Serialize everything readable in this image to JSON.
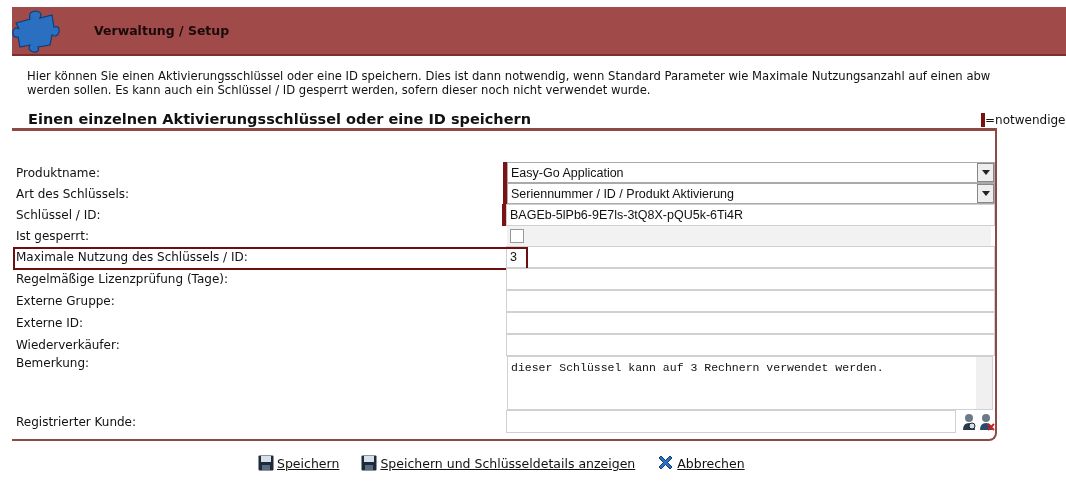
{
  "header": {
    "title": "Verwaltung / Setup"
  },
  "description": [
    "Hier können Sie einen Aktivierungsschlüssel oder eine ID speichern. Dies ist dann notwendig, wenn Standard Parameter wie Maximale Nutzungsanzahl auf einen abw",
    "werden sollen. Es kann auch ein Schlüssel / ID gesperrt werden, sofern dieser noch nicht verwendet wurde."
  ],
  "section": {
    "title": "Einen einzelnen Aktivierungsschlüssel oder eine ID speichern",
    "legend": "=notwendige"
  },
  "fields": [
    {
      "kind": "select",
      "label": "Produktname:",
      "value": "Easy-Go Application",
      "required": true,
      "highlighted": false
    },
    {
      "kind": "select",
      "label": "Art des Schlüssels:",
      "value": "Seriennummer / ID / Produkt Aktivierung",
      "required": true,
      "highlighted": false
    },
    {
      "kind": "text",
      "label": "Schlüssel / ID:",
      "value": "BAGEb-5lPb6-9E7ls-3tQ8X-pQU5k-6Ti4R",
      "required": true,
      "highlighted": false
    },
    {
      "kind": "checkbox",
      "label": "Ist gesperrt:",
      "checked": false,
      "required": false,
      "highlighted": false
    },
    {
      "kind": "text",
      "label": "Maximale Nutzung des Schlüssels / ID:",
      "value": "3",
      "required": false,
      "highlighted": true
    },
    {
      "kind": "text",
      "label": "Regelmäßige Lizenzprüfung (Tage):",
      "required": false,
      "highlighted": false
    },
    {
      "kind": "text",
      "label": "Externe Gruppe:",
      "required": false,
      "highlighted": false
    },
    {
      "kind": "text",
      "label": "Externe ID:",
      "required": false,
      "highlighted": false
    },
    {
      "kind": "text",
      "label": "Wiederverkäufer:",
      "required": false,
      "highlighted": false
    },
    {
      "kind": "textarea",
      "label": "Bemerkung:",
      "value": "dieser Schlüssel kann auf 3 Rechnern verwendet werden.",
      "required": false,
      "highlighted": false
    },
    {
      "kind": "lookup",
      "label": "Registrierter Kunde:",
      "required": false,
      "highlighted": false
    }
  ],
  "actions": [
    {
      "kind": "save",
      "label": "Speichern"
    },
    {
      "kind": "save",
      "label": "Speichern und Schlüsseldetails anzeigen"
    },
    {
      "kind": "cancel",
      "label": "Abbrechen"
    }
  ]
}
